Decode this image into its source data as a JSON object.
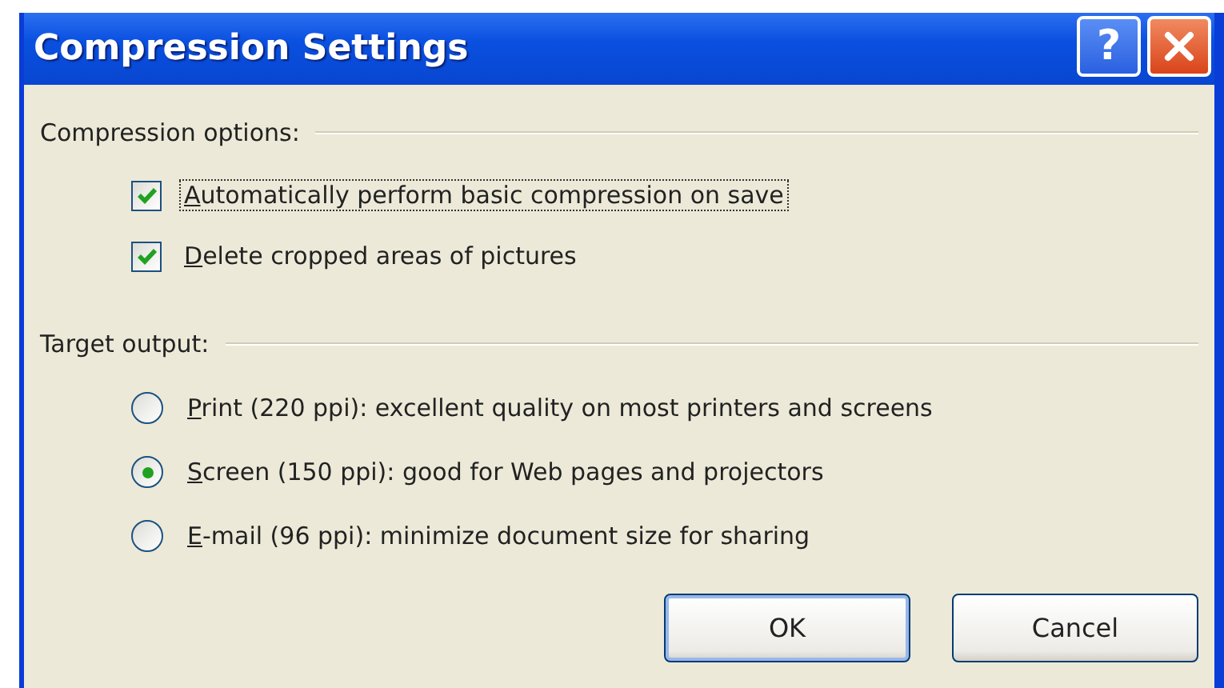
{
  "window": {
    "title": "Compression Settings",
    "controls": [
      {
        "kind": "help",
        "label": "?"
      },
      {
        "kind": "close"
      }
    ]
  },
  "groups": [
    {
      "label": "Compression options:",
      "options": [
        {
          "kind": "checkbox",
          "label": "Automatically perform basic compression on save",
          "checked": true,
          "focused": true
        },
        {
          "kind": "checkbox",
          "label": "Delete cropped areas of pictures",
          "checked": true,
          "focused": false
        }
      ]
    },
    {
      "label": "Target output:",
      "options": [
        {
          "kind": "radio",
          "label": "Print (220 ppi): excellent quality on most printers and screens",
          "selected": false,
          "focused": false
        },
        {
          "kind": "radio",
          "label": "Screen (150 ppi): good for Web pages and projectors",
          "selected": true,
          "focused": false
        },
        {
          "kind": "radio",
          "label": "E-mail (96 ppi): minimize document size for sharing",
          "selected": false,
          "focused": false
        }
      ]
    }
  ],
  "buttons": [
    {
      "label": "OK",
      "default": true
    },
    {
      "label": "Cancel",
      "default": false
    }
  ]
}
